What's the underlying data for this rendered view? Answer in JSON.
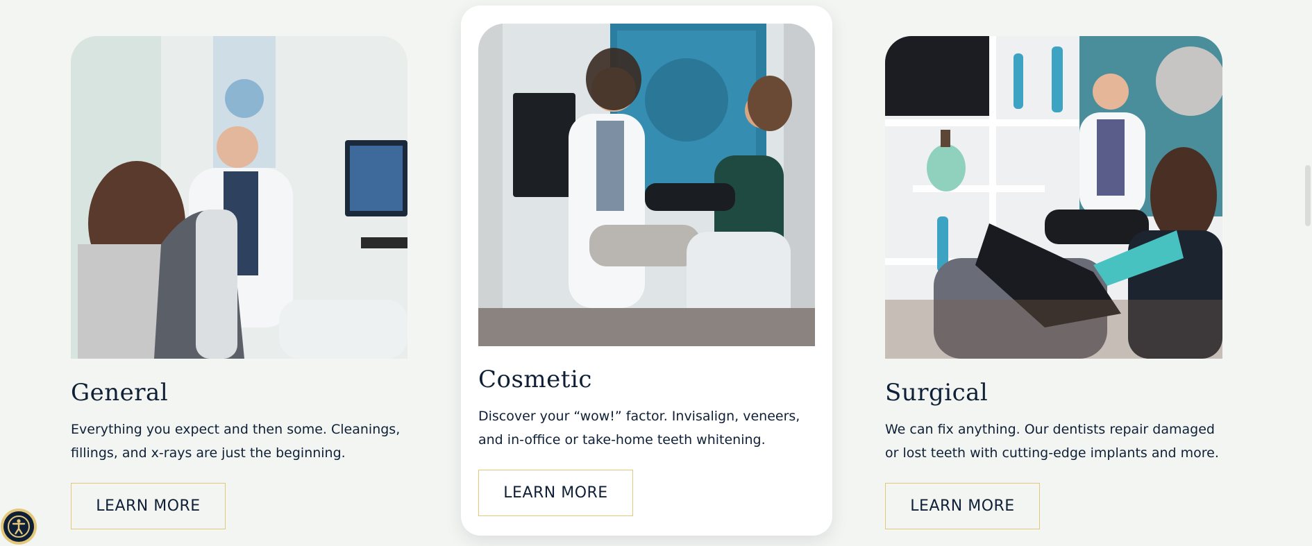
{
  "cards": [
    {
      "title": "General",
      "description": "Everything you expect and then some. Cleanings, fillings, and x-rays are just the beginning.",
      "button_label": "LEARN MORE"
    },
    {
      "title": "Cosmetic",
      "description": "Discover your “wow!” factor. Invisalign, veneers, and in-office or take-home teeth whitening.",
      "button_label": "LEARN MORE"
    },
    {
      "title": "Surgical",
      "description": "We can fix anything. Our dentists repair damaged or lost teeth with cutting-edge implants and more.",
      "button_label": "LEARN MORE"
    }
  ],
  "accessibility": {
    "icon": "accessibility-icon"
  },
  "colors": {
    "accent_gold": "#e3c77a",
    "navy": "#0f2036",
    "background": "#f3f5f2"
  }
}
